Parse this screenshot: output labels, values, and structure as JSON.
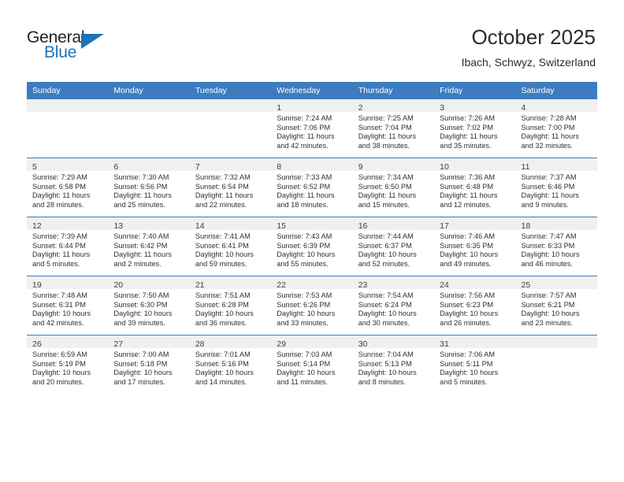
{
  "brand": {
    "name_part1": "General",
    "name_part2": "Blue",
    "accent_color": "#1d72b8"
  },
  "header": {
    "title": "October 2025",
    "subtitle": "Ibach, Schwyz, Switzerland"
  },
  "colors": {
    "header_row_blue": "#3d7dbf",
    "day_strip_gray": "#f0f0f0",
    "text": "#303030"
  },
  "weekday_headers": [
    "Sunday",
    "Monday",
    "Tuesday",
    "Wednesday",
    "Thursday",
    "Friday",
    "Saturday"
  ],
  "weeks": [
    [
      {
        "empty": true
      },
      {
        "empty": true
      },
      {
        "empty": true
      },
      {
        "day": "1",
        "sunrise": "Sunrise: 7:24 AM",
        "sunset": "Sunset: 7:06 PM",
        "daylight1": "Daylight: 11 hours",
        "daylight2": "and 42 minutes."
      },
      {
        "day": "2",
        "sunrise": "Sunrise: 7:25 AM",
        "sunset": "Sunset: 7:04 PM",
        "daylight1": "Daylight: 11 hours",
        "daylight2": "and 38 minutes."
      },
      {
        "day": "3",
        "sunrise": "Sunrise: 7:26 AM",
        "sunset": "Sunset: 7:02 PM",
        "daylight1": "Daylight: 11 hours",
        "daylight2": "and 35 minutes."
      },
      {
        "day": "4",
        "sunrise": "Sunrise: 7:28 AM",
        "sunset": "Sunset: 7:00 PM",
        "daylight1": "Daylight: 11 hours",
        "daylight2": "and 32 minutes."
      }
    ],
    [
      {
        "day": "5",
        "sunrise": "Sunrise: 7:29 AM",
        "sunset": "Sunset: 6:58 PM",
        "daylight1": "Daylight: 11 hours",
        "daylight2": "and 28 minutes."
      },
      {
        "day": "6",
        "sunrise": "Sunrise: 7:30 AM",
        "sunset": "Sunset: 6:56 PM",
        "daylight1": "Daylight: 11 hours",
        "daylight2": "and 25 minutes."
      },
      {
        "day": "7",
        "sunrise": "Sunrise: 7:32 AM",
        "sunset": "Sunset: 6:54 PM",
        "daylight1": "Daylight: 11 hours",
        "daylight2": "and 22 minutes."
      },
      {
        "day": "8",
        "sunrise": "Sunrise: 7:33 AM",
        "sunset": "Sunset: 6:52 PM",
        "daylight1": "Daylight: 11 hours",
        "daylight2": "and 18 minutes."
      },
      {
        "day": "9",
        "sunrise": "Sunrise: 7:34 AM",
        "sunset": "Sunset: 6:50 PM",
        "daylight1": "Daylight: 11 hours",
        "daylight2": "and 15 minutes."
      },
      {
        "day": "10",
        "sunrise": "Sunrise: 7:36 AM",
        "sunset": "Sunset: 6:48 PM",
        "daylight1": "Daylight: 11 hours",
        "daylight2": "and 12 minutes."
      },
      {
        "day": "11",
        "sunrise": "Sunrise: 7:37 AM",
        "sunset": "Sunset: 6:46 PM",
        "daylight1": "Daylight: 11 hours",
        "daylight2": "and 9 minutes."
      }
    ],
    [
      {
        "day": "12",
        "sunrise": "Sunrise: 7:39 AM",
        "sunset": "Sunset: 6:44 PM",
        "daylight1": "Daylight: 11 hours",
        "daylight2": "and 5 minutes."
      },
      {
        "day": "13",
        "sunrise": "Sunrise: 7:40 AM",
        "sunset": "Sunset: 6:42 PM",
        "daylight1": "Daylight: 11 hours",
        "daylight2": "and 2 minutes."
      },
      {
        "day": "14",
        "sunrise": "Sunrise: 7:41 AM",
        "sunset": "Sunset: 6:41 PM",
        "daylight1": "Daylight: 10 hours",
        "daylight2": "and 59 minutes."
      },
      {
        "day": "15",
        "sunrise": "Sunrise: 7:43 AM",
        "sunset": "Sunset: 6:39 PM",
        "daylight1": "Daylight: 10 hours",
        "daylight2": "and 55 minutes."
      },
      {
        "day": "16",
        "sunrise": "Sunrise: 7:44 AM",
        "sunset": "Sunset: 6:37 PM",
        "daylight1": "Daylight: 10 hours",
        "daylight2": "and 52 minutes."
      },
      {
        "day": "17",
        "sunrise": "Sunrise: 7:46 AM",
        "sunset": "Sunset: 6:35 PM",
        "daylight1": "Daylight: 10 hours",
        "daylight2": "and 49 minutes."
      },
      {
        "day": "18",
        "sunrise": "Sunrise: 7:47 AM",
        "sunset": "Sunset: 6:33 PM",
        "daylight1": "Daylight: 10 hours",
        "daylight2": "and 46 minutes."
      }
    ],
    [
      {
        "day": "19",
        "sunrise": "Sunrise: 7:48 AM",
        "sunset": "Sunset: 6:31 PM",
        "daylight1": "Daylight: 10 hours",
        "daylight2": "and 42 minutes."
      },
      {
        "day": "20",
        "sunrise": "Sunrise: 7:50 AM",
        "sunset": "Sunset: 6:30 PM",
        "daylight1": "Daylight: 10 hours",
        "daylight2": "and 39 minutes."
      },
      {
        "day": "21",
        "sunrise": "Sunrise: 7:51 AM",
        "sunset": "Sunset: 6:28 PM",
        "daylight1": "Daylight: 10 hours",
        "daylight2": "and 36 minutes."
      },
      {
        "day": "22",
        "sunrise": "Sunrise: 7:53 AM",
        "sunset": "Sunset: 6:26 PM",
        "daylight1": "Daylight: 10 hours",
        "daylight2": "and 33 minutes."
      },
      {
        "day": "23",
        "sunrise": "Sunrise: 7:54 AM",
        "sunset": "Sunset: 6:24 PM",
        "daylight1": "Daylight: 10 hours",
        "daylight2": "and 30 minutes."
      },
      {
        "day": "24",
        "sunrise": "Sunrise: 7:56 AM",
        "sunset": "Sunset: 6:23 PM",
        "daylight1": "Daylight: 10 hours",
        "daylight2": "and 26 minutes."
      },
      {
        "day": "25",
        "sunrise": "Sunrise: 7:57 AM",
        "sunset": "Sunset: 6:21 PM",
        "daylight1": "Daylight: 10 hours",
        "daylight2": "and 23 minutes."
      }
    ],
    [
      {
        "day": "26",
        "sunrise": "Sunrise: 6:59 AM",
        "sunset": "Sunset: 5:19 PM",
        "daylight1": "Daylight: 10 hours",
        "daylight2": "and 20 minutes."
      },
      {
        "day": "27",
        "sunrise": "Sunrise: 7:00 AM",
        "sunset": "Sunset: 5:18 PM",
        "daylight1": "Daylight: 10 hours",
        "daylight2": "and 17 minutes."
      },
      {
        "day": "28",
        "sunrise": "Sunrise: 7:01 AM",
        "sunset": "Sunset: 5:16 PM",
        "daylight1": "Daylight: 10 hours",
        "daylight2": "and 14 minutes."
      },
      {
        "day": "29",
        "sunrise": "Sunrise: 7:03 AM",
        "sunset": "Sunset: 5:14 PM",
        "daylight1": "Daylight: 10 hours",
        "daylight2": "and 11 minutes."
      },
      {
        "day": "30",
        "sunrise": "Sunrise: 7:04 AM",
        "sunset": "Sunset: 5:13 PM",
        "daylight1": "Daylight: 10 hours",
        "daylight2": "and 8 minutes."
      },
      {
        "day": "31",
        "sunrise": "Sunrise: 7:06 AM",
        "sunset": "Sunset: 5:11 PM",
        "daylight1": "Daylight: 10 hours",
        "daylight2": "and 5 minutes."
      },
      {
        "empty": true
      }
    ]
  ]
}
